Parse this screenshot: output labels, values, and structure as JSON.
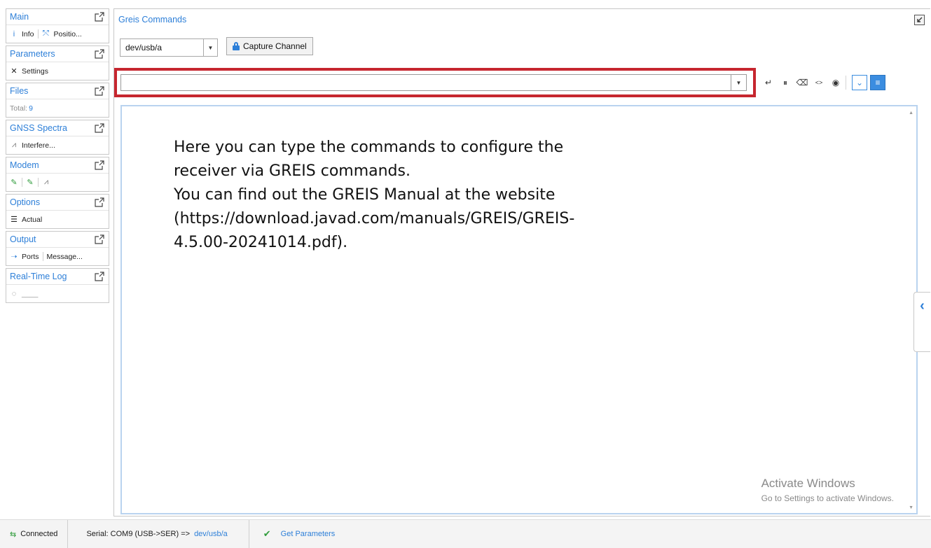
{
  "sidebar": {
    "panels": [
      {
        "title": "Main",
        "items": [
          {
            "icon": "info-icon",
            "glyph": "i",
            "label": "Info"
          },
          {
            "icon": "position-icon",
            "glyph": "⤲",
            "label": "Positio..."
          }
        ]
      },
      {
        "title": "Parameters",
        "items": [
          {
            "icon": "settings-tools-icon",
            "glyph": "✕",
            "label": "Settings"
          }
        ]
      },
      {
        "title": "Files",
        "total_label": "Total:",
        "total_value": "9"
      },
      {
        "title": "GNSS Spectra",
        "items": [
          {
            "icon": "chart-icon",
            "glyph": "⩘",
            "label": "Interfere..."
          }
        ]
      },
      {
        "title": "Modem",
        "items": [
          {
            "icon": "modem-connect-icon",
            "glyph": "✎"
          },
          {
            "icon": "modem-signal-icon",
            "glyph": "✎"
          },
          {
            "icon": "modem-chart-icon",
            "glyph": "⩘"
          }
        ]
      },
      {
        "title": "Options",
        "items": [
          {
            "icon": "list-icon",
            "glyph": "☰",
            "label": "Actual"
          }
        ]
      },
      {
        "title": "Output",
        "items": [
          {
            "icon": "ports-arrow-icon",
            "glyph": "➝",
            "label": "Ports"
          },
          {
            "label": "Message..."
          }
        ]
      },
      {
        "title": "Real-Time Log",
        "items": [
          {
            "icon": "log-status-icon",
            "glyph": "◌",
            "label": "____"
          }
        ]
      }
    ]
  },
  "main": {
    "title": "Greis Commands",
    "port_select": {
      "value": "dev/usb/a"
    },
    "capture_button": {
      "label": "Capture Channel"
    },
    "command_input": {
      "value": "",
      "placeholder": ""
    },
    "toolbar": [
      {
        "name": "send-icon",
        "glyph": "↵"
      },
      {
        "name": "pause-icon",
        "glyph": "⏸"
      },
      {
        "name": "clear-icon",
        "glyph": "⌫"
      },
      {
        "name": "hex-icon",
        "glyph": "<>"
      },
      {
        "name": "record-icon",
        "glyph": "◉"
      },
      {
        "name": "autoscroll-icon",
        "glyph": "⌄"
      },
      {
        "name": "wrap-icon",
        "glyph": "≡"
      }
    ],
    "note": {
      "line1": "Here you can type the commands to configure the receiver via GREIS commands.",
      "line2": "You can find out the GREIS Manual at the website (https://download.javad.com/manuals/GREIS/GREIS-4.5.00-20241014.pdf)."
    },
    "watermark": {
      "title": "Activate Windows",
      "subtitle": "Go to Settings to activate Windows."
    }
  },
  "statusbar": {
    "connection": "Connected",
    "serial_prefix": "Serial: COM9 (USB->SER) =>",
    "serial_port": "dev/usb/a",
    "get_parameters": "Get Parameters"
  },
  "colors": {
    "accent": "#2d7fd8",
    "highlight": "#c6262f",
    "success": "#2e9b3a"
  }
}
